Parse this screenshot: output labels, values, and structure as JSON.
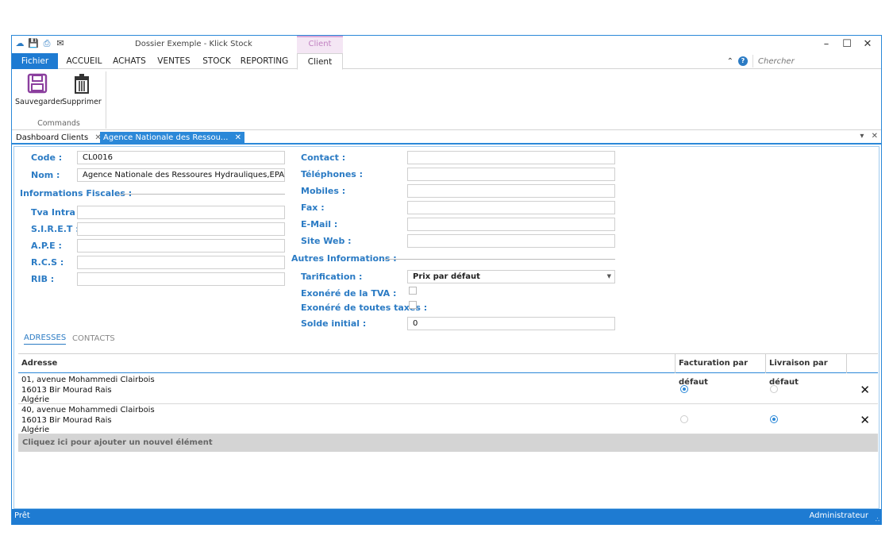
{
  "window": {
    "title": "Dossier Exemple - Klick Stock",
    "context_group": "Client",
    "minimize_icon": "minimize-icon",
    "maximize_icon": "maximize-icon",
    "close_icon": "close-icon"
  },
  "ribbon_tabs": [
    {
      "label": "Fichier"
    },
    {
      "label": "ACCUEIL"
    },
    {
      "label": "ACHATS"
    },
    {
      "label": "VENTES"
    },
    {
      "label": "STOCK"
    },
    {
      "label": "REPORTING"
    },
    {
      "label": "Client"
    }
  ],
  "search": {
    "placeholder": "Chercher"
  },
  "ribbon": {
    "save_label": "Sauvegarder",
    "delete_label": "Supprimer",
    "group_label": "Commands"
  },
  "doc_tabs": [
    {
      "label": "Dashboard"
    },
    {
      "label": "Clients"
    },
    {
      "label": "Agence Nationale des Ressou..."
    }
  ],
  "form": {
    "code_label": "Code :",
    "code_value": "CL0016",
    "nom_label": "Nom :",
    "nom_value": "Agence Nationale des Ressoures Hydrauliques,EPA,ANRH",
    "fiscal_header": "Informations Fiscales :",
    "tva_label": "Tva Intra :",
    "siret_label": "S.I.R.E.T :",
    "ape_label": "A.P.E :",
    "rcs_label": "R.C.S :",
    "rib_label": "RIB :",
    "contact_label": "Contact :",
    "tel_label": "Téléphones :",
    "mobiles_label": "Mobiles :",
    "fax_label": "Fax :",
    "email_label": "E-Mail :",
    "site_label": "Site Web :",
    "autres_header": "Autres Informations :",
    "tarif_label": "Tarification :",
    "tarif_value": "Prix par défaut",
    "exo_tva_label": "Exonéré de la TVA :",
    "exo_taxes_label": "Exonéré de toutes taxes :",
    "solde_label": "Solde initial :",
    "solde_value": "0"
  },
  "subtabs": [
    {
      "label": "ADRESSES"
    },
    {
      "label": "CONTACTS"
    }
  ],
  "grid": {
    "columns": [
      "Adresse",
      "Facturation par défaut",
      "Livraison par défaut"
    ],
    "rows": [
      {
        "line1": "01, avenue Mohammedi Clairbois",
        "line2": "16013 Bir Mourad Rais",
        "line3": "Algérie",
        "billing": true,
        "delivery": false
      },
      {
        "line1": "40, avenue Mohammedi Clairbois",
        "line2": "16013 Bir Mourad Rais",
        "line3": "Algérie",
        "billing": false,
        "delivery": true
      }
    ],
    "add_row": "Cliquez ici pour ajouter un nouvel élément"
  },
  "status": {
    "left": "Prêt",
    "right": "Administrateur"
  }
}
